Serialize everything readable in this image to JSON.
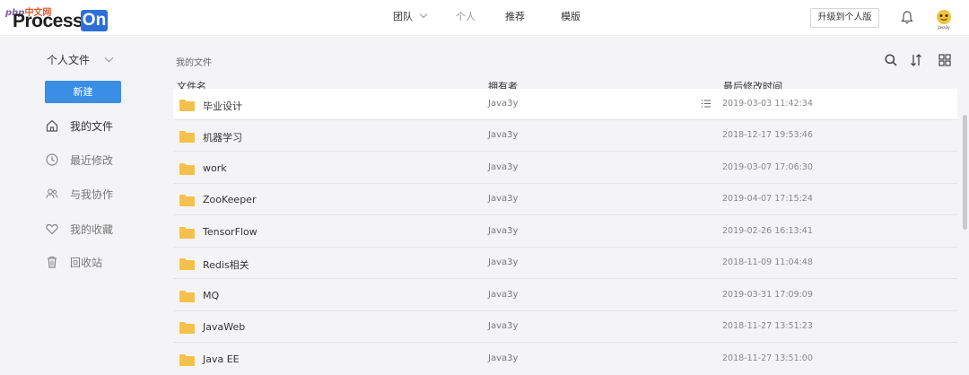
{
  "watermark": {
    "php": "php",
    "cn": "中文网"
  },
  "brand": {
    "word": "Process",
    "tag": "On"
  },
  "nav": {
    "team": "团队",
    "personal": "个人",
    "recommend": "推荐",
    "template": "模版"
  },
  "header": {
    "upgrade": "升级到个人版"
  },
  "avatar": {
    "caption": "Java3y"
  },
  "sidebar": {
    "title": "个人文件",
    "new_label": "新建",
    "items": [
      {
        "label": "我的文件",
        "icon": "home-icon"
      },
      {
        "label": "最近修改",
        "icon": "clock-icon"
      },
      {
        "label": "与我协作",
        "icon": "users-icon"
      },
      {
        "label": "我的收藏",
        "icon": "heart-icon"
      },
      {
        "label": "回收站",
        "icon": "trash-icon"
      }
    ]
  },
  "main": {
    "breadcrumb": "我的文件",
    "columns": {
      "name": "文件名",
      "owner": "拥有者",
      "modified": "最后修改时间"
    },
    "rows": [
      {
        "name": "毕业设计",
        "owner": "Java3y",
        "modified": "2019-03-03 11:42:34"
      },
      {
        "name": "机器学习",
        "owner": "Java3y",
        "modified": "2018-12-17 19:53:46"
      },
      {
        "name": "work",
        "owner": "Java3y",
        "modified": "2019-03-07 17:06:30"
      },
      {
        "name": "ZooKeeper",
        "owner": "Java3y",
        "modified": "2019-04-07 17:15:24"
      },
      {
        "name": "TensorFlow",
        "owner": "Java3y",
        "modified": "2019-02-26 16:13:41"
      },
      {
        "name": "Redis相关",
        "owner": "Java3y",
        "modified": "2018-11-09 11:04:48"
      },
      {
        "name": "MQ",
        "owner": "Java3y",
        "modified": "2019-03-31 17:09:09"
      },
      {
        "name": "JavaWeb",
        "owner": "Java3y",
        "modified": "2018-11-27 13:51:23"
      },
      {
        "name": "Java EE",
        "owner": "Java3y",
        "modified": "2018-11-27 13:51:00"
      }
    ]
  },
  "colors": {
    "accent": "#3a8ee6",
    "folder": "#f6c04d",
    "brand_on": "#2d6fd6"
  }
}
